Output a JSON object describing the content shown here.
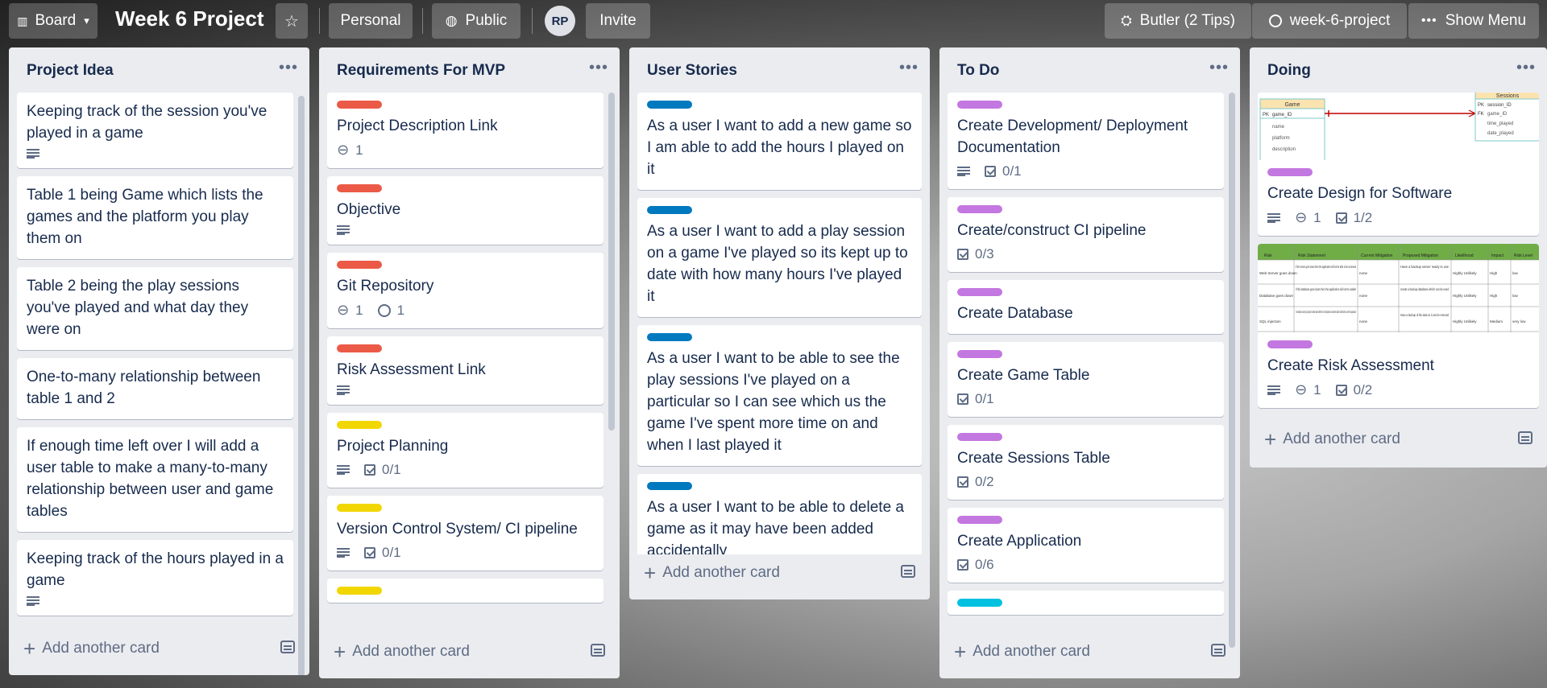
{
  "header": {
    "board_btn": "Board",
    "title": "Week 6 Project",
    "team": "Personal",
    "visibility": "Public",
    "avatar_initials": "RP",
    "invite": "Invite",
    "butler": "Butler (2 Tips)",
    "repo": "week-6-project",
    "show_menu": "Show Menu"
  },
  "label_colors": {
    "red": "#eb5a46",
    "yellow": "#f2d600",
    "blue": "#0079bf",
    "purple": "#c377e0",
    "sky": "#00c2e0"
  },
  "lists": [
    {
      "title": "Project Idea",
      "add_label": "Add another card",
      "cards": [
        {
          "text": "Keeping track of the session you've played in a game"
        },
        {
          "text": "Table 1 being Game which lists the games and the platform you play them on"
        },
        {
          "text": "Table 2 being the play sessions you've played and what day they were on"
        },
        {
          "text": "One-to-many relationship between table 1 and 2"
        },
        {
          "text": "If enough time left over I will add a user table to make a many-to-many relationship between user and game tables"
        },
        {
          "text": "Keeping track of the hours played in a game"
        }
      ]
    },
    {
      "title": "Requirements For MVP",
      "add_label": "Add another card",
      "cards": [
        {
          "text": "Project Description Link",
          "attachments": "1"
        },
        {
          "text": "Objective"
        },
        {
          "text": "Git Repository",
          "attachments": "1",
          "github": "1"
        },
        {
          "text": "Risk Assessment Link"
        },
        {
          "text": "Project Planning",
          "checklist": "0/1"
        },
        {
          "text": "Version Control System/ CI pipeline",
          "checklist": "0/1"
        }
      ]
    },
    {
      "title": "User Stories",
      "add_label": "Add another card",
      "cards": [
        {
          "text": "As a user I want to add a new game so I am able to add the hours I played on it"
        },
        {
          "text": "As a user I want to add a play session on a game I've played so its kept up to date with how many hours I've played it"
        },
        {
          "text": "As a user I want to be able to see the play sessions I've played on a particular so I can see which us the game I've spent more time on and when I last played it"
        },
        {
          "text": "As a user I want to be able to delete a game as it may have been added accidentally"
        }
      ]
    },
    {
      "title": "To Do",
      "add_label": "Add another card",
      "cards": [
        {
          "text": "Create Development/ Deployment Documentation",
          "checklist": "0/1"
        },
        {
          "text": "Create/construct CI pipeline",
          "checklist": "0/3"
        },
        {
          "text": "Create Database"
        },
        {
          "text": "Create Game Table",
          "checklist": "0/1"
        },
        {
          "text": "Create Sessions Table",
          "checklist": "0/2"
        },
        {
          "text": "Create Application",
          "checklist": "0/6"
        }
      ]
    },
    {
      "title": "Doing",
      "add_label": "Add another card",
      "cards": [
        {
          "text": "Create Design for Software",
          "attachments": "1",
          "checklist": "1/2"
        },
        {
          "text": "Create Risk Assessment",
          "attachments": "1",
          "checklist": "0/2"
        }
      ]
    }
  ],
  "erd": {
    "game_title": "Game",
    "game_pk": "PK",
    "game_id": "game_ID",
    "game_f1": "name",
    "game_f2": "platform",
    "game_f3": "description",
    "sess_title": "Sessions",
    "sess_pk": "PK",
    "sess_fk": "FK",
    "sess_id": "session_ID",
    "sess_f1": "game_ID",
    "sess_f2": "time_played",
    "sess_f3": "date_played"
  },
  "risk_table": {
    "headers": [
      "Risk",
      "Risk Statement",
      "Current Mitigation",
      "Proposed Mitigation",
      "Likelihood",
      "Impact",
      "Risk Level"
    ],
    "rows": [
      [
        "Web Server goes down",
        "If the server goes down then the application will not be able to be accessed",
        "none",
        "Have a backup server ready to use",
        "Highly Unlikely",
        "High",
        "low"
      ],
      [
        "Database goes down",
        "If the database goes down then the application will not be usable",
        "none",
        "create a backup database which can be used",
        "Highly Unlikely",
        "High",
        "low"
      ],
      [
        "SQL injection",
        "If an attacker uses SQL injection to delete data while this is not important as sensitive data it will affect the use of the application",
        "none",
        "Have a backup of the data so it can be restored",
        "Highly Unlikely",
        "Medium",
        "very low"
      ]
    ]
  }
}
